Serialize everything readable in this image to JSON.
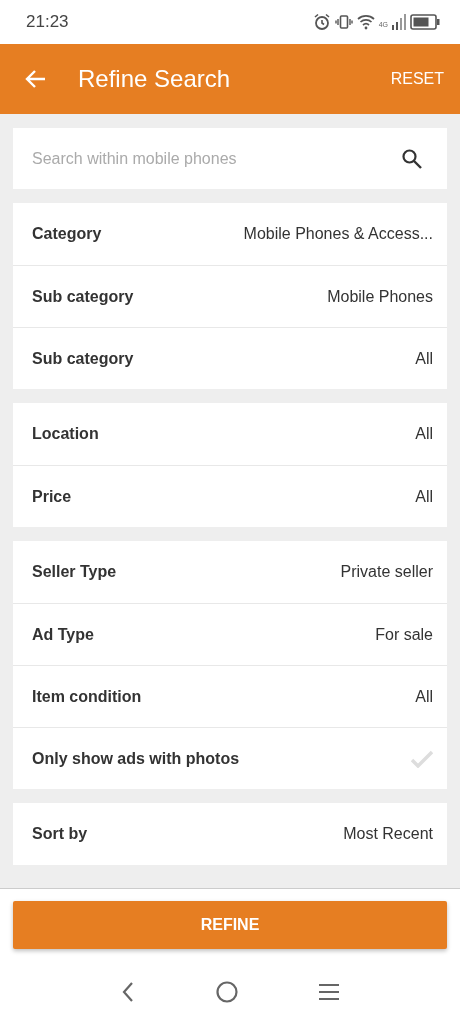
{
  "status_bar": {
    "time": "21:23",
    "network": "4G"
  },
  "header": {
    "title": "Refine Search",
    "action": "RESET"
  },
  "search": {
    "placeholder": "Search within mobile phones"
  },
  "groups": [
    {
      "rows": [
        {
          "kind": "value",
          "label": "Category",
          "value": "Mobile Phones & Access..."
        },
        {
          "kind": "value",
          "label": "Sub category",
          "value": "Mobile Phones"
        },
        {
          "kind": "value",
          "label": "Sub category",
          "value": "All"
        }
      ]
    },
    {
      "rows": [
        {
          "kind": "value",
          "label": "Location",
          "value": "All"
        },
        {
          "kind": "value",
          "label": "Price",
          "value": "All"
        }
      ]
    },
    {
      "rows": [
        {
          "kind": "value",
          "label": "Seller Type",
          "value": "Private seller"
        },
        {
          "kind": "value",
          "label": "Ad Type",
          "value": "For sale"
        },
        {
          "kind": "value",
          "label": "Item condition",
          "value": "All"
        },
        {
          "kind": "checkbox",
          "label": "Only show ads with photos",
          "checked": false
        }
      ]
    },
    {
      "rows": [
        {
          "kind": "value",
          "label": "Sort by",
          "value": "Most Recent"
        }
      ]
    }
  ],
  "button": "REFINE"
}
